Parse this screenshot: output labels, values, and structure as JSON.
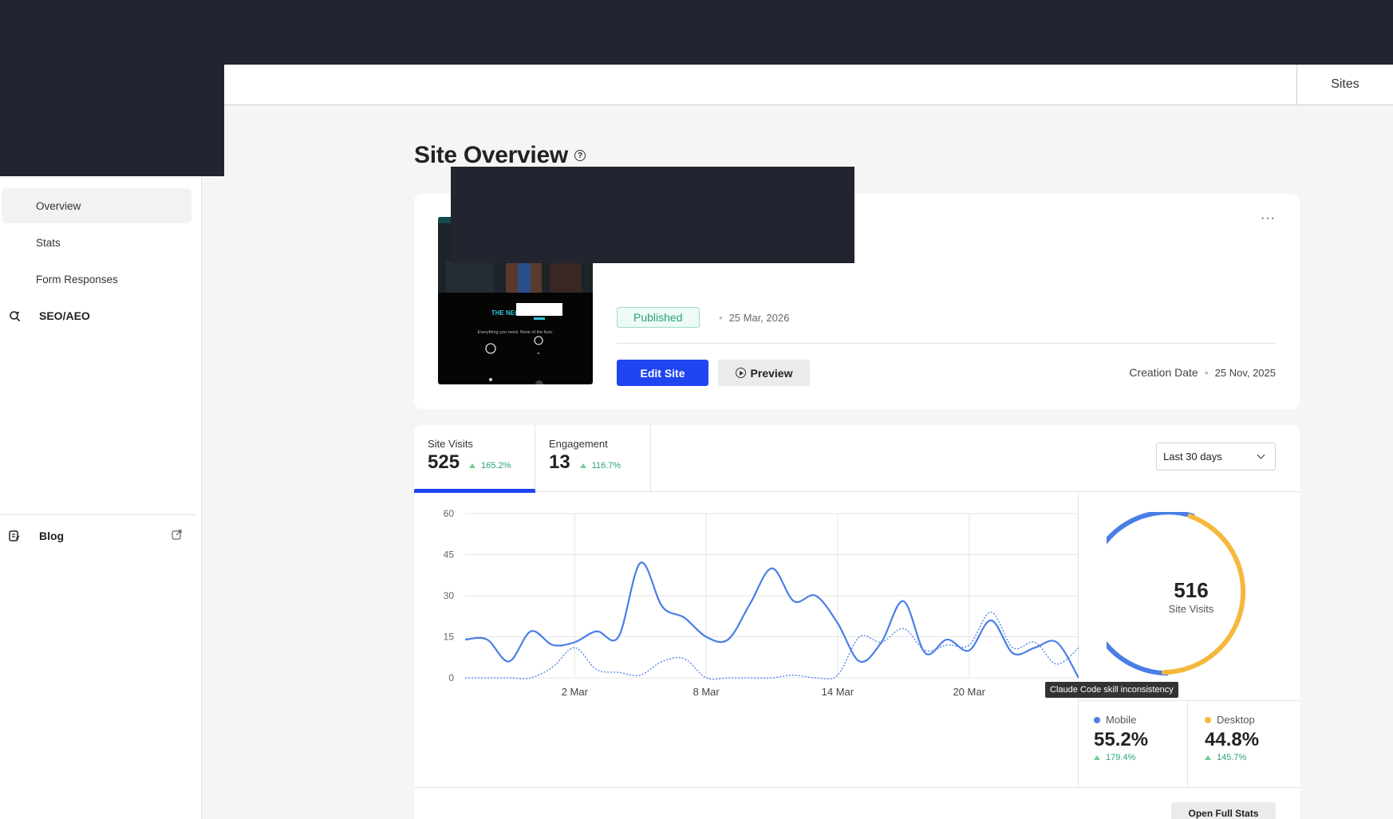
{
  "header": {
    "sites_tab": "Sites"
  },
  "sidebar": {
    "items": [
      {
        "label": "Overview"
      },
      {
        "label": "Stats"
      },
      {
        "label": "Form Responses"
      }
    ],
    "seo": {
      "label": "SEO/AEO",
      "icon": "search-icon"
    },
    "blog": {
      "label": "Blog",
      "icon": "document-icon",
      "ext_icon": "external-link-icon"
    }
  },
  "page": {
    "title": "Site Overview",
    "help_icon": "question-icon"
  },
  "site_card": {
    "more_label": "···",
    "thumbnail": {
      "brand": "THE NEON ELM",
      "tagline": "Everything you need. None of the fuss."
    },
    "status": "Published",
    "published_date": "25 Mar, 2026",
    "edit_label": "Edit Site",
    "preview_label": "Preview",
    "creation_label": "Creation Date",
    "creation_date": "25 Nov, 2025",
    "separator": "•"
  },
  "stats": {
    "tabs": [
      {
        "label": "Site Visits",
        "value": "525",
        "change": "165.2%"
      },
      {
        "label": "Engagement",
        "value": "13",
        "change": "116.7%"
      }
    ],
    "range": "Last 30 days",
    "tooltip": "Claude Code skill inconsistency",
    "donut": {
      "value": "516",
      "label": "Site Visits"
    },
    "devices": [
      {
        "label": "Mobile",
        "value": "55.2%",
        "change": "179.4%",
        "color": "#4a7ee6"
      },
      {
        "label": "Desktop",
        "value": "44.8%",
        "change": "145.7%",
        "color": "#f5b83d"
      }
    ],
    "full_stats_label": "Open Full Stats"
  },
  "chart_data": [
    {
      "type": "line",
      "ylim": [
        0,
        60
      ],
      "yticks": [
        "0",
        "15",
        "30",
        "45",
        "60"
      ],
      "xticks": [
        "2 Mar",
        "8 Mar",
        "14 Mar",
        "20 Mar"
      ],
      "x": [
        0,
        1,
        2,
        3,
        4,
        5,
        6,
        7,
        8,
        9,
        10,
        11,
        12,
        13,
        14,
        15,
        16,
        17,
        18,
        19,
        20,
        21,
        22,
        23,
        24,
        25,
        26,
        27,
        28
      ],
      "series": [
        {
          "values": [
            14,
            14,
            6,
            17,
            12,
            13,
            17,
            15,
            42,
            26,
            22,
            15,
            14,
            27,
            40,
            28,
            30,
            20,
            6,
            13,
            28,
            9,
            14,
            10,
            21,
            9,
            11,
            13,
            0
          ],
          "color": "#4a7ee6",
          "style": "solid"
        },
        {
          "values": [
            0,
            0,
            0,
            0,
            4,
            11,
            3,
            2,
            1,
            6,
            7,
            0,
            0,
            0,
            0,
            1,
            0,
            1,
            15,
            13,
            18,
            10,
            12,
            12,
            24,
            11,
            13,
            5,
            11
          ],
          "color": "#4a7ee6",
          "style": "dotted"
        }
      ]
    },
    {
      "type": "pie",
      "categories": [
        "Mobile",
        "Desktop"
      ],
      "values": [
        55.2,
        44.8
      ],
      "colors": [
        "#4a7ee6",
        "#f5b83d"
      ]
    }
  ]
}
